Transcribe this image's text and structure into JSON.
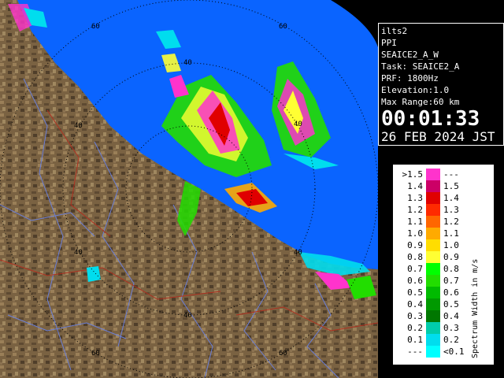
{
  "info_panel": {
    "site": "ilts2",
    "mode": "PPI",
    "scan": "SEAICE2_A_W",
    "task": "Task: SEAICE2_A",
    "prf": "PRF: 1800Hz",
    "elevation": "Elevation:1.0",
    "max_range": "Max Range:60 km",
    "time": "00:01:33",
    "date": "26 FEB 2024 JST"
  },
  "range_labels": [
    "60",
    "40",
    "40",
    "60",
    "40",
    "40",
    "40",
    "60",
    "60",
    "40",
    "40",
    "60"
  ],
  "legend": {
    "title": "Spectrum Width in m/s",
    "rows": [
      {
        "left": ">1.5",
        "right": "---",
        "color": "#ff33cc"
      },
      {
        "left": "1.4",
        "right": "1.5",
        "color": "#cc0066"
      },
      {
        "left": "1.3",
        "right": "1.4",
        "color": "#e00000"
      },
      {
        "left": "1.2",
        "right": "1.3",
        "color": "#ff2a00"
      },
      {
        "left": "1.1",
        "right": "1.2",
        "color": "#ff6600"
      },
      {
        "left": "1.0",
        "right": "1.1",
        "color": "#ffaa00"
      },
      {
        "left": "0.9",
        "right": "1.0",
        "color": "#ffdd00"
      },
      {
        "left": "0.8",
        "right": "0.9",
        "color": "#ffff33"
      },
      {
        "left": "0.7",
        "right": "0.8",
        "color": "#00ff00"
      },
      {
        "left": "0.6",
        "right": "0.7",
        "color": "#22dd00"
      },
      {
        "left": "0.5",
        "right": "0.6",
        "color": "#00bb00"
      },
      {
        "left": "0.4",
        "right": "0.5",
        "color": "#009900"
      },
      {
        "left": "0.3",
        "right": "0.4",
        "color": "#007700"
      },
      {
        "left": "0.2",
        "right": "0.3",
        "color": "#00ccaa"
      },
      {
        "left": "0.1",
        "right": "0.2",
        "color": "#00ddee"
      },
      {
        "left": "---",
        "right": "<0.1",
        "color": "#00ffff"
      }
    ]
  },
  "colors": {
    "sea": "#0a64ff",
    "land": "#7a6242",
    "range_rings": "#000000",
    "background": "#000000"
  }
}
